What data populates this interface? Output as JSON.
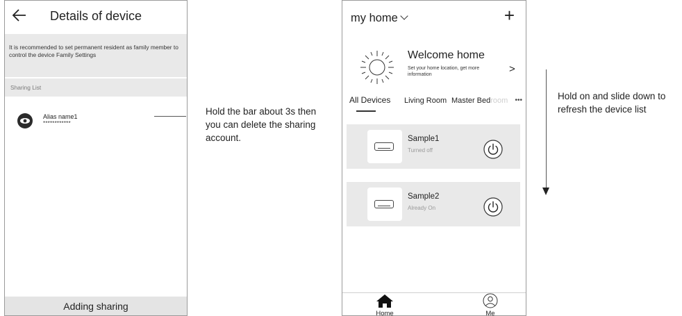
{
  "details": {
    "title": "Details of device",
    "notice": "It is recommended to set permanent resident as family member to control the device Family Settings",
    "sharing_list_label": "Sharing List",
    "share_item": {
      "alias": "Alias name1",
      "masked": "************"
    },
    "add_button": "Adding sharing"
  },
  "callout_left": "Hold the bar about 3s then you can delete the sharing account.",
  "home": {
    "title": "my home",
    "add_symbol": "+",
    "welcome": "Welcome home",
    "welcome_sub": "Set your home location, get more information",
    "more_symbol": ">",
    "tabs": [
      "All Devices",
      "Living Room",
      "Master Bed",
      "room"
    ],
    "tabs_more": "•••",
    "devices": [
      {
        "name": "Sample1",
        "status": "Turned off"
      },
      {
        "name": "Sample2",
        "status": "Already On"
      }
    ],
    "nav": {
      "home": "Home",
      "me": "Me"
    }
  },
  "callout_right": "Hold on and slide down to refresh the device list",
  "icons": {
    "back": "left-arrow-icon",
    "chevron": "chevron-down-icon",
    "sun": "sun-icon",
    "power": "power-icon",
    "ac": "air-conditioner-icon",
    "home": "home-icon",
    "user": "user-icon"
  }
}
